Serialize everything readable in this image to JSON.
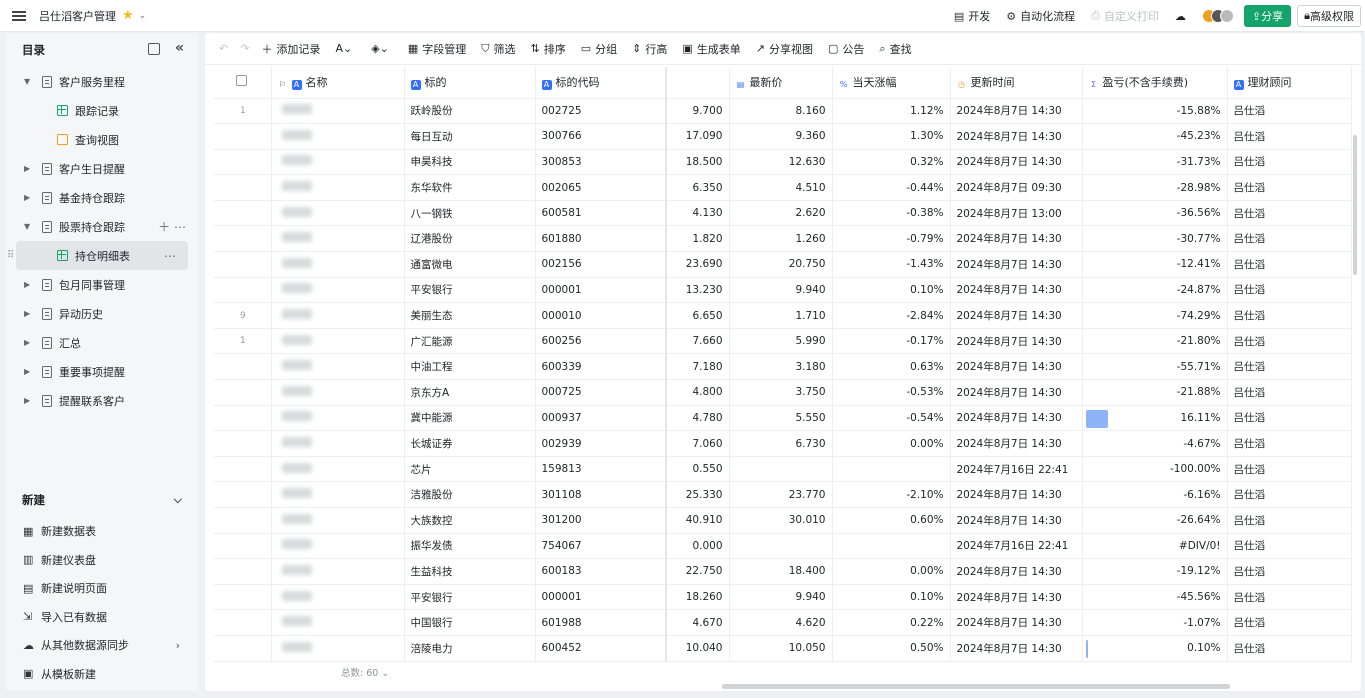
{
  "app": {
    "title": "吕仕滔客户管理"
  },
  "topbar": {
    "items": [
      {
        "label": "开发",
        "icon": "calendar-icon",
        "enabled": true
      },
      {
        "label": "自动化流程",
        "icon": "robot-icon",
        "enabled": true
      },
      {
        "label": "自定义打印",
        "icon": "printer-icon",
        "enabled": false
      }
    ],
    "share_label": "分享",
    "permission_label": "高级权限"
  },
  "sidebar": {
    "title": "目录",
    "tree": [
      {
        "label": "客户服务里程",
        "expanded": true,
        "level": 0
      },
      {
        "label": "跟踪记录",
        "level": 1,
        "type": "grid"
      },
      {
        "label": "查询视图",
        "level": 1,
        "type": "view"
      },
      {
        "label": "客户生日提醒",
        "level": 0
      },
      {
        "label": "基金持仓跟踪",
        "level": 0
      },
      {
        "label": "股票持仓跟踪",
        "expanded": true,
        "level": 0
      },
      {
        "label": "持仓明细表",
        "level": 1,
        "type": "grid",
        "selected": true
      },
      {
        "label": "包月同事管理",
        "level": 0
      },
      {
        "label": "异动历史",
        "level": 0
      },
      {
        "label": "汇总",
        "level": 0
      },
      {
        "label": "重要事项提醒",
        "level": 0
      },
      {
        "label": "提醒联系客户",
        "level": 0
      }
    ],
    "new_section": {
      "title": "新建",
      "items": [
        {
          "label": "新建数据表",
          "icon": "table-icon"
        },
        {
          "label": "新建仪表盘",
          "icon": "dashboard-icon"
        },
        {
          "label": "新建说明页面",
          "icon": "doc-icon"
        },
        {
          "label": "导入已有数据",
          "icon": "import-icon"
        },
        {
          "label": "从其他数据源同步",
          "icon": "cloud-icon",
          "has_arrow": true
        },
        {
          "label": "从模板新建",
          "icon": "template-icon"
        }
      ]
    }
  },
  "toolbar": {
    "items": [
      {
        "label": "添加记录",
        "icon": "plus-icon"
      },
      {
        "label": "",
        "icon": "text-color-icon"
      },
      {
        "label": "",
        "icon": "fill-color-icon"
      },
      {
        "label": "字段管理",
        "icon": "fields-icon"
      },
      {
        "label": "筛选",
        "icon": "filter-icon"
      },
      {
        "label": "排序",
        "icon": "sort-icon"
      },
      {
        "label": "分组",
        "icon": "group-icon"
      },
      {
        "label": "行高",
        "icon": "row-height-icon"
      },
      {
        "label": "生成表单",
        "icon": "form-icon"
      },
      {
        "label": "分享视图",
        "icon": "share-view-icon"
      },
      {
        "label": "公告",
        "icon": "announce-icon"
      },
      {
        "label": "查找",
        "icon": "search-icon"
      }
    ]
  },
  "table": {
    "columns": [
      "",
      "名称",
      "标的",
      "标的代码",
      "",
      "最新价",
      "当天涨幅",
      "更新时间",
      "盈亏(不含手续费)",
      "理财顾问"
    ],
    "rows": [
      {
        "idx": "1",
        "name": "跃岭股份",
        "code": "002725",
        "cost": "9.700",
        "price": "8.160",
        "chg": "1.12%",
        "time": "2024年8月7日 14:30",
        "pnl": "-15.88%",
        "adv": "吕仕滔",
        "bar": 0
      },
      {
        "idx": "",
        "name": "每日互动",
        "code": "300766",
        "cost": "17.090",
        "price": "9.360",
        "chg": "1.30%",
        "time": "2024年8月7日 14:30",
        "pnl": "-45.23%",
        "adv": "吕仕滔",
        "bar": 0
      },
      {
        "idx": "",
        "name": "申昊科技",
        "code": "300853",
        "cost": "18.500",
        "price": "12.630",
        "chg": "0.32%",
        "time": "2024年8月7日 14:30",
        "pnl": "-31.73%",
        "adv": "吕仕滔",
        "bar": 0
      },
      {
        "idx": "",
        "name": "东华软件",
        "code": "002065",
        "cost": "6.350",
        "price": "4.510",
        "chg": "-0.44%",
        "time": "2024年8月7日 09:30",
        "pnl": "-28.98%",
        "adv": "吕仕滔",
        "bar": 0
      },
      {
        "idx": "",
        "name": "八一钢铁",
        "code": "600581",
        "cost": "4.130",
        "price": "2.620",
        "chg": "-0.38%",
        "time": "2024年8月7日 13:00",
        "pnl": "-36.56%",
        "adv": "吕仕滔",
        "bar": 0
      },
      {
        "idx": "",
        "name": "辽港股份",
        "code": "601880",
        "cost": "1.820",
        "price": "1.260",
        "chg": "-0.79%",
        "time": "2024年8月7日 14:30",
        "pnl": "-30.77%",
        "adv": "吕仕滔",
        "bar": 0
      },
      {
        "idx": "",
        "name": "通富微电",
        "code": "002156",
        "cost": "23.690",
        "price": "20.750",
        "chg": "-1.43%",
        "time": "2024年8月7日 14:30",
        "pnl": "-12.41%",
        "adv": "吕仕滔",
        "bar": 0
      },
      {
        "idx": "",
        "name": "平安银行",
        "code": "000001",
        "cost": "13.230",
        "price": "9.940",
        "chg": "0.10%",
        "time": "2024年8月7日 14:30",
        "pnl": "-24.87%",
        "adv": "吕仕滔",
        "bar": 0
      },
      {
        "idx": "9",
        "name": "美丽生态",
        "code": "000010",
        "cost": "6.650",
        "price": "1.710",
        "chg": "-2.84%",
        "time": "2024年8月7日 14:30",
        "pnl": "-74.29%",
        "adv": "吕仕滔",
        "bar": 0
      },
      {
        "idx": "1",
        "name": "广汇能源",
        "code": "600256",
        "cost": "7.660",
        "price": "5.990",
        "chg": "-0.17%",
        "time": "2024年8月7日 14:30",
        "pnl": "-21.80%",
        "adv": "吕仕滔",
        "bar": 0
      },
      {
        "idx": "",
        "name": "中油工程",
        "code": "600339",
        "cost": "7.180",
        "price": "3.180",
        "chg": "0.63%",
        "time": "2024年8月7日 14:30",
        "pnl": "-55.71%",
        "adv": "吕仕滔",
        "bar": 0
      },
      {
        "idx": "",
        "name": "京东方A",
        "code": "000725",
        "cost": "4.800",
        "price": "3.750",
        "chg": "-0.53%",
        "time": "2024年8月7日 14:30",
        "pnl": "-21.88%",
        "adv": "吕仕滔",
        "bar": 0
      },
      {
        "idx": "",
        "name": "冀中能源",
        "code": "000937",
        "cost": "4.780",
        "price": "5.550",
        "chg": "-0.54%",
        "time": "2024年8月7日 14:30",
        "pnl": "16.11%",
        "adv": "吕仕滔",
        "bar": 0.16
      },
      {
        "idx": "",
        "name": "长城证券",
        "code": "002939",
        "cost": "7.060",
        "price": "6.730",
        "chg": "0.00%",
        "time": "2024年8月7日 14:30",
        "pnl": "-4.67%",
        "adv": "吕仕滔",
        "bar": 0
      },
      {
        "idx": "",
        "name": "芯片",
        "code": "159813",
        "cost": "0.550",
        "price": "",
        "chg": "",
        "time": "2024年7月16日 22:41",
        "pnl": "-100.00%",
        "adv": "吕仕滔",
        "bar": 0
      },
      {
        "idx": "",
        "name": "洁雅股份",
        "code": "301108",
        "cost": "25.330",
        "price": "23.770",
        "chg": "-2.10%",
        "time": "2024年8月7日 14:30",
        "pnl": "-6.16%",
        "adv": "吕仕滔",
        "bar": 0
      },
      {
        "idx": "",
        "name": "大族数控",
        "code": "301200",
        "cost": "40.910",
        "price": "30.010",
        "chg": "0.60%",
        "time": "2024年8月7日 14:30",
        "pnl": "-26.64%",
        "adv": "吕仕滔",
        "bar": 0
      },
      {
        "idx": "",
        "name": "振华发债",
        "code": "754067",
        "cost": "0.000",
        "price": "",
        "chg": "",
        "time": "2024年7月16日 22:41",
        "pnl": "#DIV/0!",
        "adv": "吕仕滔",
        "bar": 0
      },
      {
        "idx": "",
        "name": "生益科技",
        "code": "600183",
        "cost": "22.750",
        "price": "18.400",
        "chg": "0.00%",
        "time": "2024年8月7日 14:30",
        "pnl": "-19.12%",
        "adv": "吕仕滔",
        "bar": 0
      },
      {
        "idx": "",
        "name": "平安银行",
        "code": "000001",
        "cost": "18.260",
        "price": "9.940",
        "chg": "0.10%",
        "time": "2024年8月7日 14:30",
        "pnl": "-45.56%",
        "adv": "吕仕滔",
        "bar": 0
      },
      {
        "idx": "",
        "name": "中国银行",
        "code": "601988",
        "cost": "4.670",
        "price": "4.620",
        "chg": "0.22%",
        "time": "2024年8月7日 14:30",
        "pnl": "-1.07%",
        "adv": "吕仕滔",
        "bar": 0
      },
      {
        "idx": "",
        "name": "涪陵电力",
        "code": "600452",
        "cost": "10.040",
        "price": "10.050",
        "chg": "0.50%",
        "time": "2024年8月7日 14:30",
        "pnl": "0.10%",
        "adv": "吕仕滔",
        "bar": 0.01
      }
    ]
  },
  "footer": {
    "count_label": "总数: 60"
  }
}
